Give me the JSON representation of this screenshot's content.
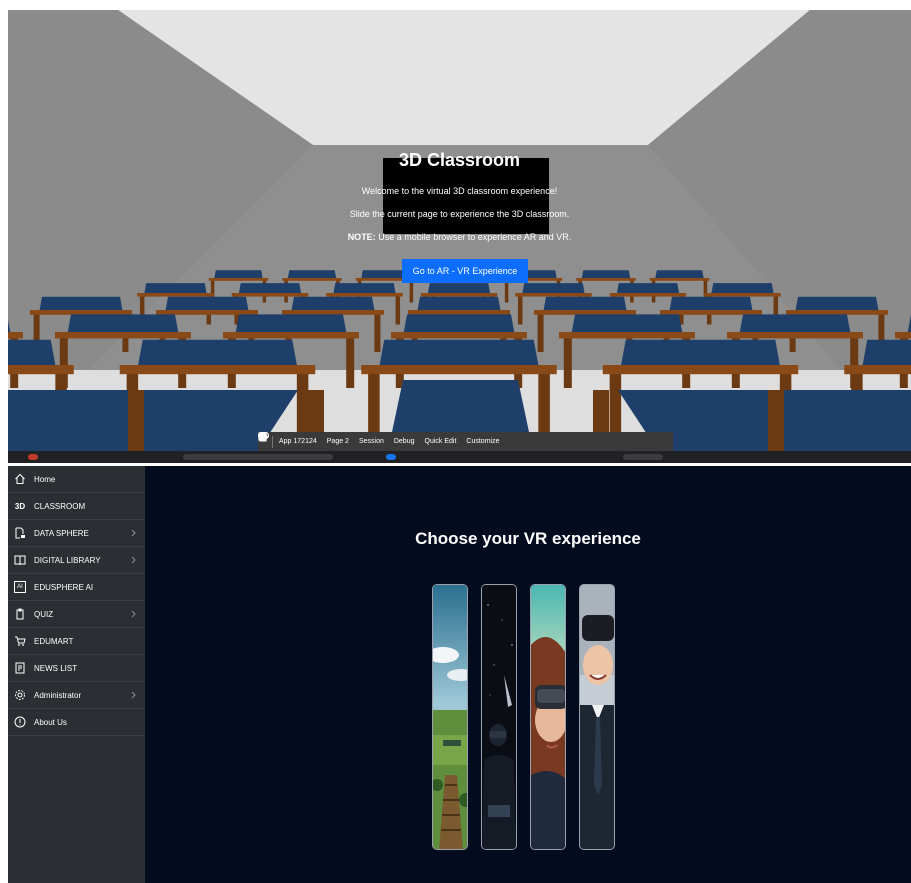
{
  "classroom": {
    "title": "3D Classroom",
    "line1": "Welcome to the virtual 3D classroom experience!",
    "line2": "Slide the current page to experience the 3D classroom.",
    "note_label": "NOTE:",
    "note_text": " Use a mobile browser to experience AR and VR.",
    "ar_button": "Go to AR - VR Experience"
  },
  "toolbar": {
    "app": "App 172124",
    "page": "Page 2",
    "session": "Session",
    "debug": "Debug",
    "quick_edit": "Quick Edit",
    "customize": "Customize"
  },
  "sidebar": {
    "items": [
      {
        "label": "Home",
        "icon": "home-icon",
        "chevron": false
      },
      {
        "label": "CLASSROOM",
        "icon": "3d-icon",
        "icon_text": "3D",
        "chevron": false
      },
      {
        "label": "DATA SPHERE",
        "icon": "data-sphere-icon",
        "chevron": true
      },
      {
        "label": "DIGITAL LIBRARY",
        "icon": "book-icon",
        "chevron": true
      },
      {
        "label": "EDUSPHERE AI",
        "icon": "ai-icon",
        "icon_text": "AI",
        "chevron": false
      },
      {
        "label": "QUIZ",
        "icon": "quiz-icon",
        "chevron": true
      },
      {
        "label": "EDUMART",
        "icon": "cart-icon",
        "chevron": false
      },
      {
        "label": "NEWS LIST",
        "icon": "news-icon",
        "chevron": false
      },
      {
        "label": "Administrator",
        "icon": "gear-icon",
        "chevron": true
      },
      {
        "label": "About Us",
        "icon": "info-icon",
        "chevron": false
      }
    ]
  },
  "main": {
    "title": "Choose your VR experience"
  },
  "colors": {
    "accent": "#0d6efd",
    "sidebar_bg": "#2b2f33",
    "main_bg": "#030b1e",
    "desk_wood": "#8a4a17",
    "desk_seat": "#1f3f6b"
  }
}
